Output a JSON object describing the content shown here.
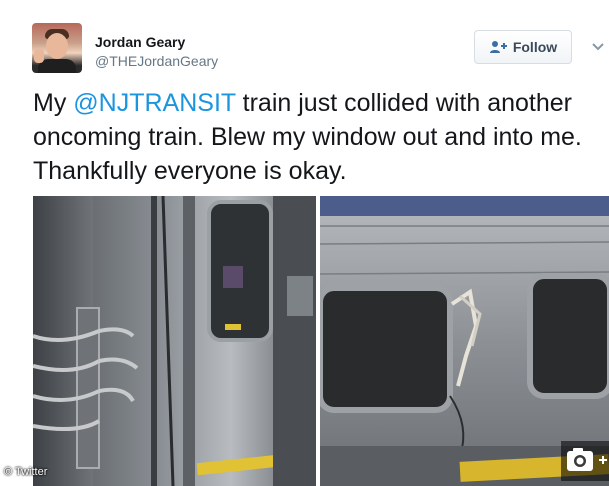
{
  "user": {
    "name": "Jordan Geary",
    "handle": "@THEJordanGeary"
  },
  "follow_button": {
    "label": "Follow"
  },
  "tweet": {
    "prefix": "My ",
    "mention": "@NJTRANSIT",
    "suffix": " train just collided with another oncoming train. Blew my window out and into me. Thankfully everyone is okay."
  },
  "photo_credit": "© Twitter",
  "colors": {
    "mention": "#1b95e0",
    "follow_text": "#3b4a5a"
  },
  "icons": {
    "follow": "add-user-icon",
    "menu": "chevron-down-icon",
    "gallery": "camera-icon"
  }
}
